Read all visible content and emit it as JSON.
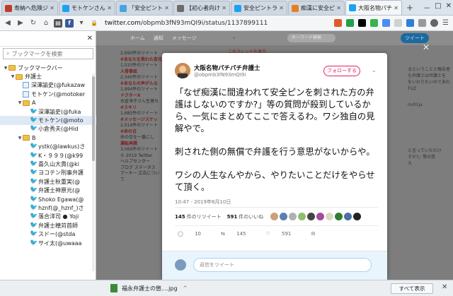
{
  "tabs": [
    {
      "label": "寿納へ危険ジ",
      "icon_color": "#c0392b",
      "active": false
    },
    {
      "label": "モトケンさん",
      "icon_color": "#1da1f2",
      "active": false
    },
    {
      "label": "「安全ピント",
      "icon_color": "#4aa3df",
      "active": false
    },
    {
      "label": "【初心者向け",
      "icon_color": "#6c6c6c",
      "active": false
    },
    {
      "label": "安全ピントラ",
      "icon_color": "#1da1f2",
      "active": false
    },
    {
      "label": "痴漢に安全ピ",
      "icon_color": "#e67e22",
      "active": false
    },
    {
      "label": "大阪名物パチ",
      "icon_color": "#1da1f2",
      "active": true
    }
  ],
  "window_controls": {
    "minimize": "－",
    "maximize": "□",
    "close": "✕"
  },
  "address": {
    "prefix": "",
    "domain": "twitter.com",
    "path": "/obpmb3fN93mQI9i/status/1137899111..."
  },
  "sidebar": {
    "search_placeholder": "ブックマークを検索",
    "close_glyph": "✕",
    "items": [
      {
        "label": "ブックマークバー",
        "kind": "folder",
        "indent": 0,
        "toggle": "▼"
      },
      {
        "label": "弁護士",
        "kind": "folder",
        "indent": 1,
        "toggle": "▼"
      },
      {
        "label": "深澤諭史(@fukazaw",
        "kind": "page",
        "indent": 2
      },
      {
        "label": "モトケン(@motoker",
        "kind": "page",
        "indent": 2
      },
      {
        "label": "A",
        "kind": "folder",
        "indent": 2,
        "toggle": "▼"
      },
      {
        "label": "深澤諭史(@fuka",
        "kind": "bird",
        "indent": 3
      },
      {
        "label": "モトケン(@moto",
        "kind": "bird",
        "indent": 3,
        "selected": true
      },
      {
        "label": "小倉秀夫(@Hid",
        "kind": "bird",
        "indent": 3
      },
      {
        "label": "B",
        "kind": "folder",
        "indent": 2,
        "toggle": "▼"
      },
      {
        "label": "ystk(@lawkus)さ",
        "kind": "bird",
        "indent": 3
      },
      {
        "label": "K・９９９(@k99",
        "kind": "bird",
        "indent": 3
      },
      {
        "label": "喜久山大貴(@ki",
        "kind": "bird",
        "indent": 3
      },
      {
        "label": "ヨコテン刑事弁護",
        "kind": "bird",
        "indent": 3
      },
      {
        "label": "弁護士秋重実(@",
        "kind": "bird",
        "indent": 3
      },
      {
        "label": "弁護士神原元(@",
        "kind": "bird",
        "indent": 3
      },
      {
        "label": "Shoko Egawa(@",
        "kind": "bird",
        "indent": 3
      },
      {
        "label": "hznf(@_hznf_)さ",
        "kind": "bird",
        "indent": 3
      },
      {
        "label": "落合洋司 ● Yoji",
        "kind": "bird",
        "indent": 3
      },
      {
        "label": "弁護士穂苅首師",
        "kind": "bird",
        "indent": 3
      },
      {
        "label": "スドー(@stda",
        "kind": "bird",
        "indent": 3
      },
      {
        "label": "サイ太(@uwaaa",
        "kind": "bird",
        "indent": 3
      }
    ]
  },
  "twitter_bg": {
    "nav": [
      "ホーム",
      "通知",
      "メッセージ"
    ],
    "search_placeholder": "キーワード検索",
    "tweet_button": "ツイート",
    "thread_note": "このスレッドを表示",
    "left_lines": [
      {
        "text": "2,690件のツイート",
        "hd": false
      },
      {
        "text": "#あなたを救わた変化",
        "hd": true
      },
      {
        "text": "1,533件のツイート",
        "hd": false
      },
      {
        "text": "人骨事故",
        "hd": true
      },
      {
        "text": "2,340件のツイート",
        "hd": false
      },
      {
        "text": "#あなたの声がんな",
        "hd": true
      },
      {
        "text": "1,994件のツイート",
        "hd": false
      },
      {
        "text": "ドクターX",
        "hd": true
      },
      {
        "text": "水倉淳子さん生激ち",
        "hd": false
      },
      {
        "text": "#スキリ",
        "hd": true
      },
      {
        "text": "1,685件のツイート",
        "hd": false
      },
      {
        "text": "#メッセージスケッ",
        "hd": true
      },
      {
        "text": "2,014件のツイート",
        "hd": false
      },
      {
        "text": "#命の日",
        "hd": true
      },
      {
        "text": "命の日を一番にし",
        "hd": false
      },
      {
        "text": "運転再開",
        "hd": true
      },
      {
        "text": "3,069件のツイート",
        "hd": false
      },
      {
        "text": "© 2019 Twitter",
        "hd": false
      },
      {
        "text": "ヘルプセンター",
        "hd": false
      },
      {
        "text": "ブログ ステータス",
        "hd": false
      },
      {
        "text": "アーキー 広告について",
        "hd": false
      }
    ],
    "right_lines": [
      "るということと報告者",
      "も弁護士は弁護士を",
      "をいわりたいのであれ",
      "れば",
      "m/01ja",
      "と言っていただけ",
      "すか?」等の質",
      "え"
    ]
  },
  "tweet": {
    "display_name": "大阪名物パチパチ弁護士",
    "handle": "@obpmb3fN93mQI9i",
    "follow_label": "フォローする",
    "chevron": "⌄",
    "paragraphs": [
      "「なぜ痴漢に間違われて安全ピンを刺された方の弁護はしないのですか?」等の質問が殺到しているから、一気にまとめてここで答えるわ。ワシ独自の見解やで。",
      "刺された側の無償で弁護を行う意思がないからや。",
      "ワシの人生なんやから、やりたいことだけをやらせて頂く。"
    ],
    "timestamp": "10:47 - 2019年6月10日",
    "retweets_count": "145",
    "retweets_label": "件のリツイート",
    "likes_count": "591",
    "likes_label": "件のいいね",
    "like_avatar_colors": [
      "#c9a27a",
      "#5b7fb0",
      "#b0b0b0",
      "#8fbf6a",
      "#444444",
      "#a34b9e",
      "#ddd9c0",
      "#2e7d32",
      "#4a6fa5",
      "#222222"
    ],
    "reply_count": "10",
    "rt_count": "145",
    "like_count": "591",
    "reply_icon": "◯",
    "rt_icon": "⇆",
    "like_icon": "♡",
    "dm_icon": "✉",
    "reply_placeholder": "返信をツイート"
  },
  "modal_close": "✕",
  "download": {
    "filename": "福永弁護士の懲....jpg",
    "chevron": "^",
    "show_all": "すべて表示",
    "close": "✕"
  }
}
